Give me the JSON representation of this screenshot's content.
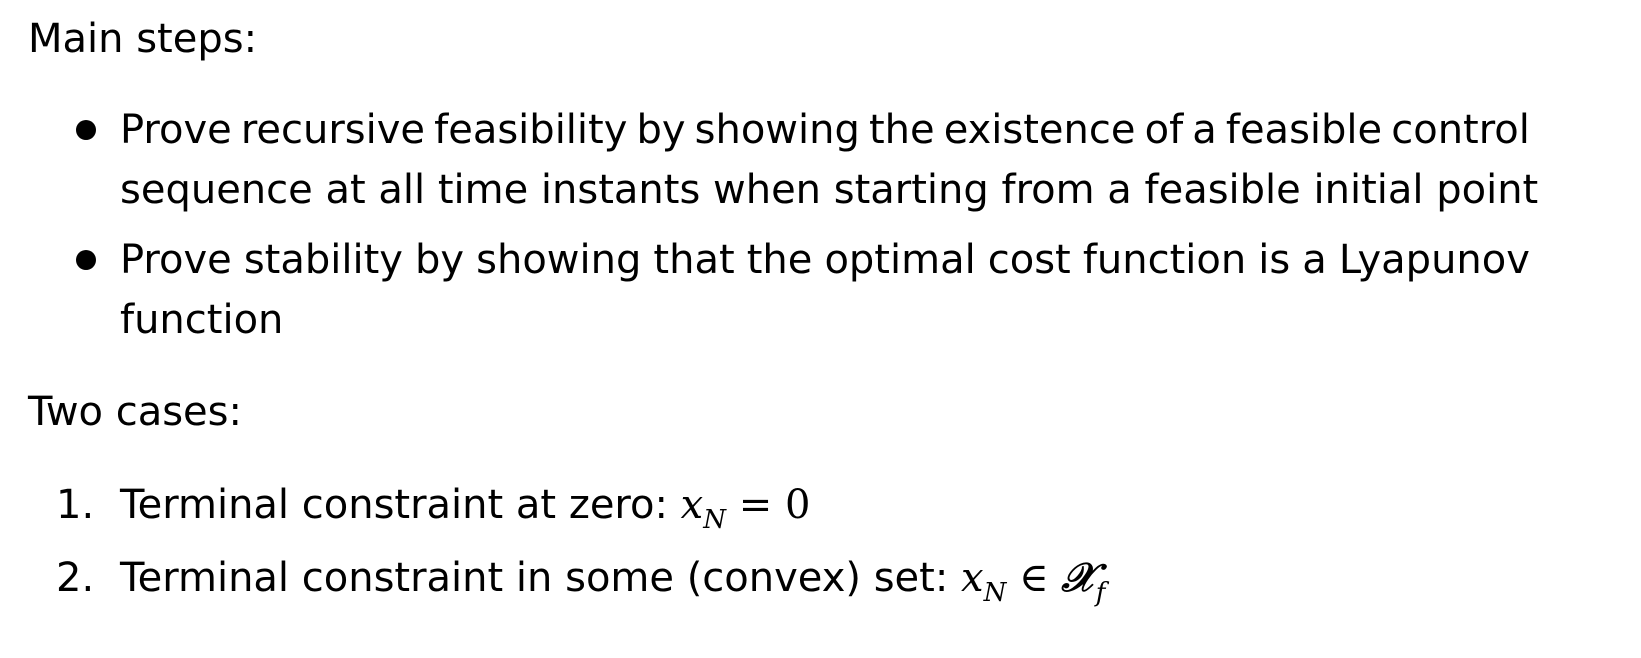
{
  "main_steps": {
    "heading": "Main steps:",
    "bullets": [
      {
        "words_line1": [
          "Prove",
          "recursive",
          "feasibility",
          "by",
          "showing",
          "the",
          "existence",
          "of",
          "a",
          "feasible",
          "control"
        ],
        "line2": "sequence at all time instants when starting from a feasible initial point"
      },
      {
        "words_line1": [
          "Prove",
          "stability",
          "by",
          "showing",
          "that",
          "the",
          "optimal",
          "cost",
          "function",
          "is",
          "a",
          "Lyapunov"
        ],
        "line2": "function"
      }
    ]
  },
  "two_cases": {
    "heading": "Two cases:",
    "items": [
      {
        "number": "1.",
        "text": "Terminal constraint at zero: ",
        "math": {
          "var": "x",
          "sub": "N",
          "relation": " = ",
          "rhs": "0"
        }
      },
      {
        "number": "2.",
        "text": "Terminal constraint in some (convex) set: ",
        "math": {
          "var": "x",
          "sub": "N",
          "relation": " ∈ ",
          "set": "𝒳",
          "set_sub": "f"
        }
      }
    ]
  }
}
